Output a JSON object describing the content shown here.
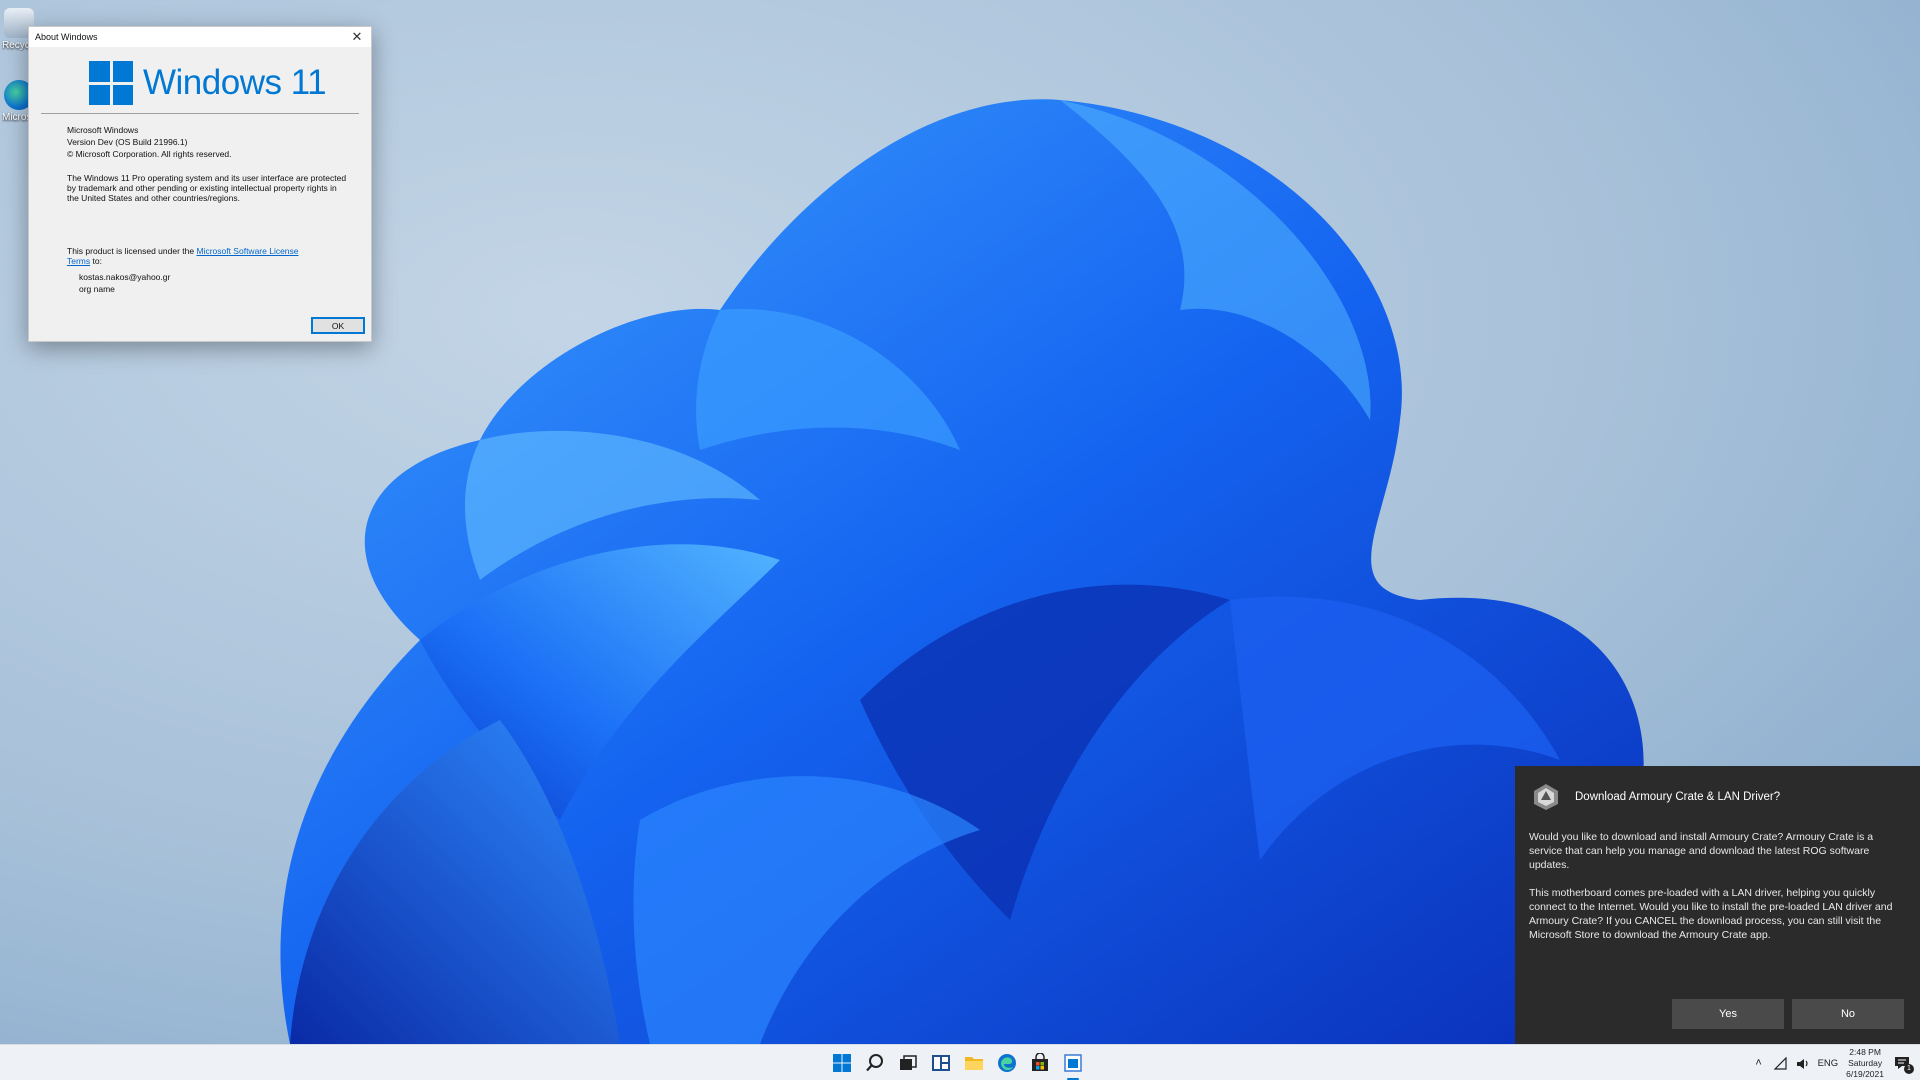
{
  "desktop": {
    "icons": [
      {
        "label": "Recycle Bin",
        "icon": "recycle-bin-icon"
      },
      {
        "label": "Microsoft Edge",
        "icon": "edge-icon"
      }
    ]
  },
  "about_dialog": {
    "title": "About Windows",
    "close_icon": "close-icon",
    "logo_text": "Windows 11",
    "logo_color": "#0078d4",
    "product": "Microsoft Windows",
    "version": "Version Dev (OS Build 21996.1)",
    "copyright": "© Microsoft Corporation. All rights reserved.",
    "legal": "The Windows 11 Pro operating system and its user interface are protected by trademark and other pending or existing intellectual property rights in the United States and other countries/regions.",
    "license_prefix": "This product is licensed under the ",
    "license_link": "Microsoft Software License Terms",
    "license_suffix": " to:",
    "owner_user": "kostas.nakos@yahoo.gr",
    "owner_org": "org name",
    "ok_label": "OK"
  },
  "toast": {
    "app_icon": "armoury-crate-icon",
    "title": "Download Armoury Crate & LAN Driver?",
    "body_1": "Would you like to download and install Armoury Crate? Armoury Crate is a service that can help you manage and download the latest ROG software updates.",
    "body_2": "This motherboard comes pre-loaded with a LAN driver, helping you quickly connect to the Internet. Would you like to install the pre-loaded LAN driver and Armoury Crate? If you CANCEL the download process, you can still visit the Microsoft Store to download the Armoury Crate app.",
    "yes_label": "Yes",
    "no_label": "No",
    "background": "#2b2b2b"
  },
  "taskbar": {
    "apps": [
      "start-icon",
      "search-icon",
      "task-view-icon",
      "widgets-icon",
      "file-explorer-icon",
      "edge-icon",
      "store-icon",
      "winver-icon"
    ],
    "active_app": "winver-icon",
    "tray": {
      "language": "ENG",
      "time": "2:48 PM",
      "day": "Saturday",
      "date": "6/19/2021",
      "notification_count": "1"
    }
  }
}
